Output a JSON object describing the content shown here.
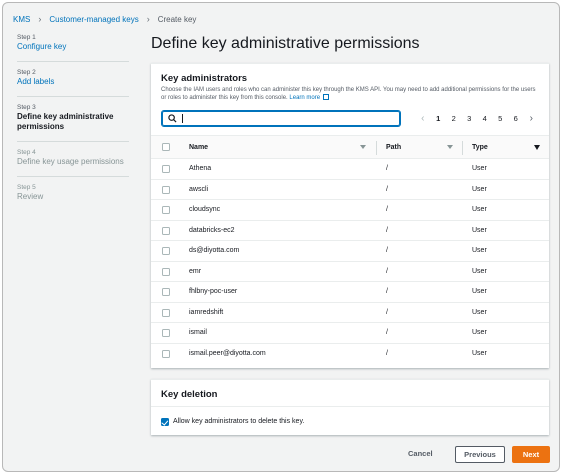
{
  "breadcrumb": {
    "items": [
      "KMS",
      "Customer-managed keys",
      "Create key"
    ],
    "separator": "›"
  },
  "steps": [
    {
      "num": "Step 1",
      "title": "Configure key",
      "state": "link"
    },
    {
      "num": "Step 2",
      "title": "Add labels",
      "state": "link"
    },
    {
      "num": "Step 3",
      "title": "Define key administrative permissions",
      "state": "current"
    },
    {
      "num": "Step 4",
      "title": "Define key usage permissions",
      "state": "disabled"
    },
    {
      "num": "Step 5",
      "title": "Review",
      "state": "disabled"
    }
  ],
  "page_title": "Define key administrative permissions",
  "key_admins": {
    "title": "Key administrators",
    "description": "Choose the IAM users and roles who can administer this key through the KMS API. You may need to add additional permissions for the users or roles to administer this key from this console.",
    "learn_more": "Learn more",
    "search": {
      "value": "",
      "placeholder": ""
    },
    "pagination": {
      "pages": [
        "1",
        "2",
        "3",
        "4",
        "5",
        "6"
      ],
      "current": "1"
    },
    "columns": {
      "name": "Name",
      "path": "Path",
      "type": "Type"
    },
    "rows": [
      {
        "name": "Athena",
        "path": "/",
        "type": "User"
      },
      {
        "name": "awscli",
        "path": "/",
        "type": "User"
      },
      {
        "name": "cloudsync",
        "path": "/",
        "type": "User"
      },
      {
        "name": "databricks-ec2",
        "path": "/",
        "type": "User"
      },
      {
        "name": "ds@diyotta.com",
        "path": "/",
        "type": "User"
      },
      {
        "name": "emr",
        "path": "/",
        "type": "User"
      },
      {
        "name": "fhlbny-poc-user",
        "path": "/",
        "type": "User"
      },
      {
        "name": "iamredshift",
        "path": "/",
        "type": "User"
      },
      {
        "name": "ismail",
        "path": "/",
        "type": "User"
      },
      {
        "name": "ismail.peer@diyotta.com",
        "path": "/",
        "type": "User"
      }
    ]
  },
  "key_deletion": {
    "title": "Key deletion",
    "checkbox_label": "Allow key administrators to delete this key.",
    "checked": true
  },
  "footer": {
    "cancel": "Cancel",
    "previous": "Previous",
    "next": "Next"
  },
  "colors": {
    "link": "#0073bb",
    "primary": "#ec7211",
    "background": "#f2f3f3"
  },
  "icons": {
    "search": "search-icon",
    "external": "external-link-icon",
    "sort": "sort-caret-icon"
  }
}
